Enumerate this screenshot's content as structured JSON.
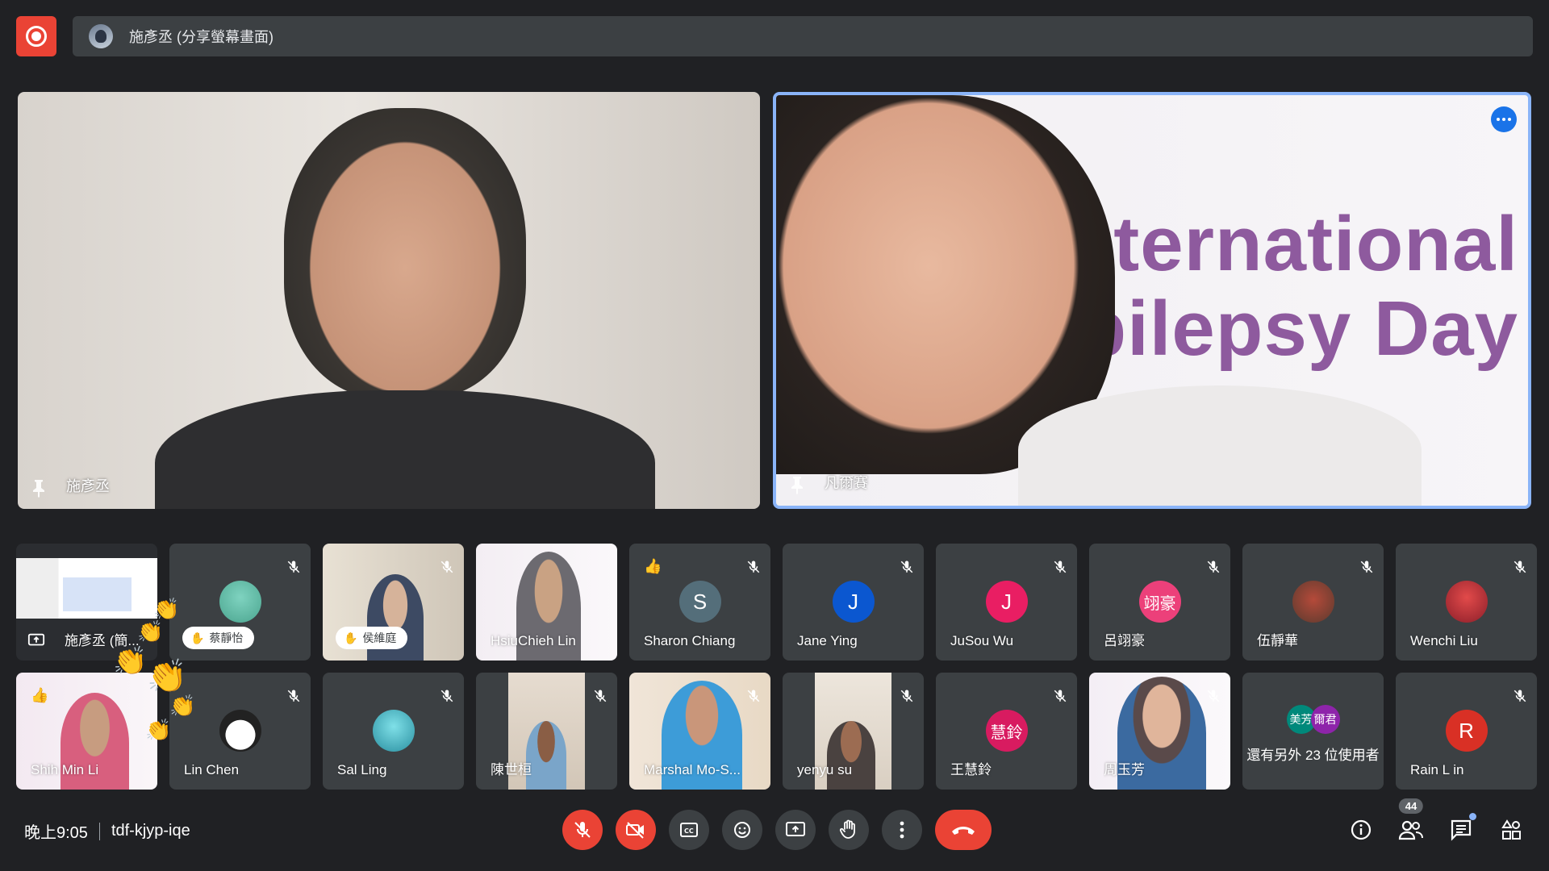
{
  "top_bar": {
    "presenter_label": "施彥丞 (分享螢幕畫面)"
  },
  "main_tiles": [
    {
      "name": "施彥丞"
    },
    {
      "name": "凡爾賽",
      "overlay_line1": "ternational",
      "overlay_line2": "pilepsy Day"
    }
  ],
  "participants_row1": [
    {
      "name": "施彥丞 (簡...",
      "type": "screen"
    },
    {
      "name": "蔡靜怡",
      "type": "avatar-img",
      "hand_raised": true
    },
    {
      "name": "侯維庭",
      "type": "video",
      "hand_raised": true
    },
    {
      "name": "HsiuChieh Lin",
      "type": "video"
    },
    {
      "name": "Sharon Chiang",
      "type": "initial",
      "initial": "S",
      "color": "#546e7a",
      "reaction": "👍"
    },
    {
      "name": "Jane Ying",
      "type": "initial",
      "initial": "J",
      "color": "#0b57d0"
    },
    {
      "name": "JuSou Wu",
      "type": "initial",
      "initial": "J",
      "color": "#e91e63"
    },
    {
      "name": "呂翊豪",
      "type": "initial",
      "initial": "翊豪",
      "color": "#ec407a"
    },
    {
      "name": "伍靜華",
      "type": "avatar-img"
    },
    {
      "name": "Wenchi Liu",
      "type": "avatar-img"
    }
  ],
  "participants_row2": [
    {
      "name": "Shih Min Li",
      "type": "video",
      "reaction": "👍"
    },
    {
      "name": "Lin Chen",
      "type": "avatar-img"
    },
    {
      "name": "Sal Ling",
      "type": "avatar-img"
    },
    {
      "name": "陳世桓",
      "type": "video"
    },
    {
      "name": "Marshal Mo-S...",
      "type": "video"
    },
    {
      "name": "yenyu su",
      "type": "video"
    },
    {
      "name": "王慧鈴",
      "type": "initial",
      "initial": "慧鈴",
      "color": "#d81b60"
    },
    {
      "name": "周玉芳",
      "type": "video"
    },
    {
      "name": "還有另外 23 位使用者",
      "type": "others",
      "avatars": [
        "美芳",
        "爾君"
      ]
    },
    {
      "name": "Rain L in",
      "type": "initial",
      "initial": "R",
      "color": "#d93025"
    }
  ],
  "bottom_bar": {
    "time": "晚上9:05",
    "meeting_code": "tdf-kjyp-iqe",
    "participant_count": "44"
  },
  "icons": {
    "record": "record-icon",
    "mic": "mic-off-icon",
    "camera": "camera-off-icon",
    "captions": "captions-icon",
    "emoji": "emoji-icon",
    "present": "present-icon",
    "hand": "raise-hand-icon",
    "more": "more-vert-icon",
    "end": "end-call-icon",
    "info": "info-icon",
    "people": "people-icon",
    "chat": "chat-icon",
    "activities": "activities-icon"
  },
  "colors": {
    "background": "#202124",
    "tile": "#3c4043",
    "danger": "#ea4335",
    "active_speaker": "#8ab4f8"
  }
}
